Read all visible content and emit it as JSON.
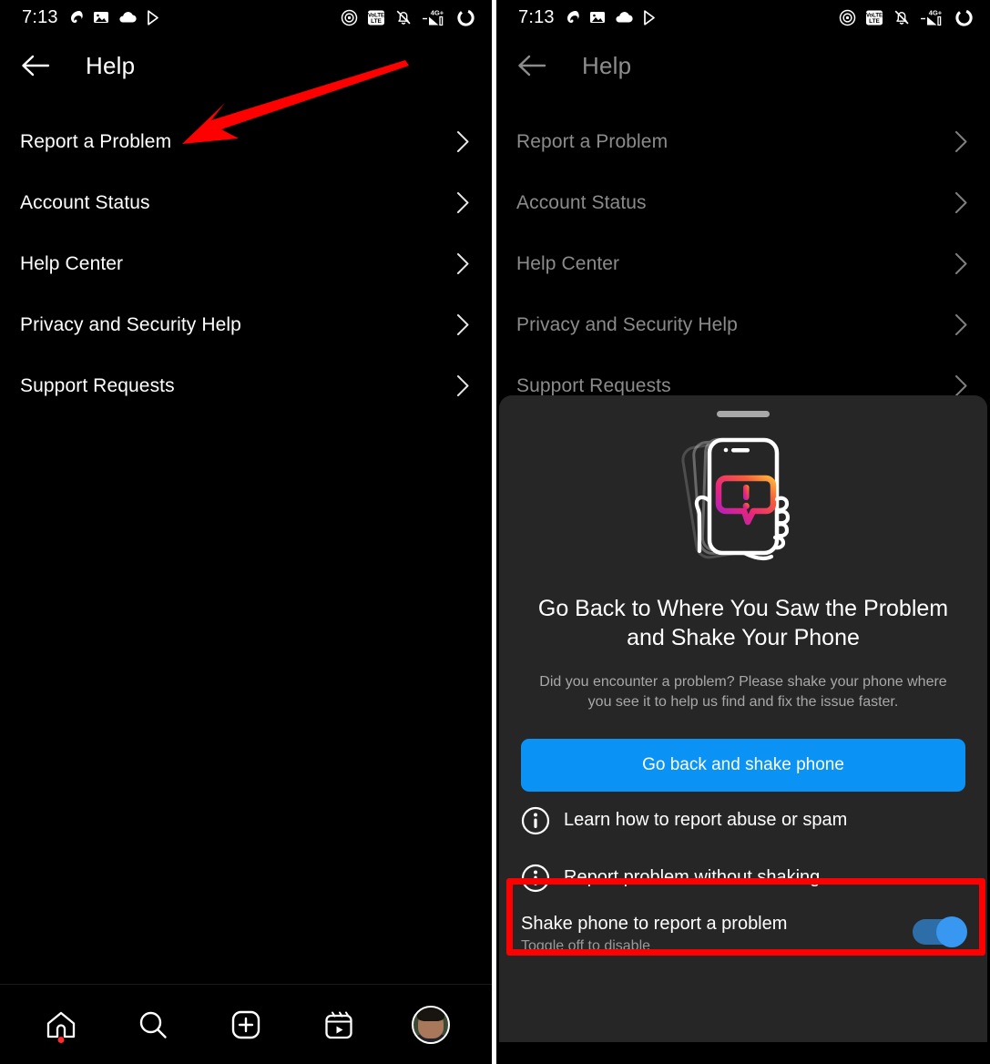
{
  "status_bar": {
    "time": "7:13",
    "left_icons": [
      "swirl-icon",
      "photos-icon",
      "cloud-icon",
      "play-store-icon"
    ],
    "right_icons": [
      "cast-icon",
      "volte-icon",
      "bell-muted-icon",
      "signal-4g-plus-icon",
      "battery-ring-icon"
    ],
    "network_label": "4G+",
    "volte_label": "VoLTE"
  },
  "header": {
    "title": "Help",
    "back_icon": "arrow-left-icon"
  },
  "menu": {
    "items": [
      {
        "label": "Report a Problem"
      },
      {
        "label": "Account Status"
      },
      {
        "label": "Help Center"
      },
      {
        "label": "Privacy and Security Help"
      },
      {
        "label": "Support Requests"
      }
    ]
  },
  "bottom_nav": {
    "items": [
      {
        "name": "home-icon",
        "badge": true
      },
      {
        "name": "search-icon",
        "badge": false
      },
      {
        "name": "create-icon",
        "badge": false
      },
      {
        "name": "reels-icon",
        "badge": false
      },
      {
        "name": "profile-avatar",
        "badge": false
      }
    ]
  },
  "sheet": {
    "handle": "drag-handle",
    "illustration": "hand-shaking-phone-illustration",
    "title": "Go Back to Where You Saw the Problem and Shake Your Phone",
    "subtitle": "Did you encounter a problem? Please shake your phone where you see it to help us find and fix the issue faster.",
    "primary_button": "Go back and shake phone",
    "options": [
      {
        "label": "Learn how to report abuse or spam",
        "icon": "info-circle-icon"
      },
      {
        "label": "Report problem without shaking",
        "icon": "info-circle-icon",
        "highlighted": true
      }
    ],
    "toggle": {
      "title": "Shake phone to report a problem",
      "subtitle": "Toggle off to disable",
      "state": "on"
    }
  },
  "annotations": {
    "arrow": {
      "color": "#ff0000",
      "points_to": "Report a Problem"
    },
    "highlight_box": {
      "color": "#ff0000",
      "target": "Report problem without shaking"
    }
  },
  "colors": {
    "background": "#000000",
    "sheet_background": "#262626",
    "accent_blue": "#0a93f5",
    "annotation_red": "#ff0000",
    "muted_text": "#a8a8a8",
    "dim_text": "#8b8b8b"
  }
}
